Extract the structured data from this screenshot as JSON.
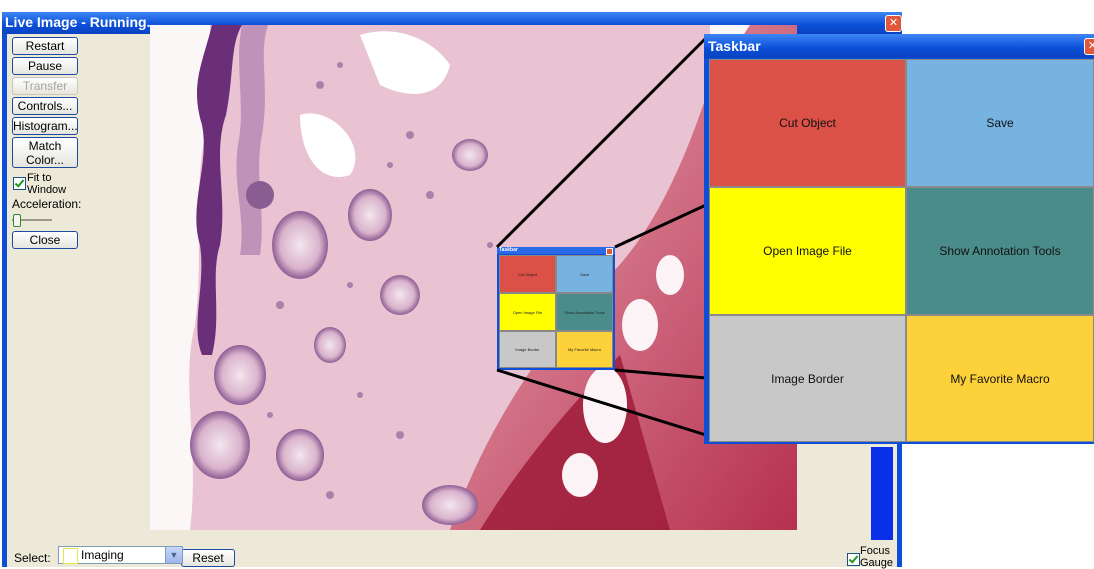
{
  "window": {
    "title": "Live Image - Running...",
    "close_icon": "close-icon"
  },
  "left_panel": {
    "restart": "Restart",
    "pause": "Pause",
    "transfer": "Transfer",
    "controls": "Controls...",
    "histogram": "Histogram...",
    "match_color_line1": "Match",
    "match_color_line2": "Color...",
    "fit_to_window_line1": "Fit to",
    "fit_to_window_line2": "Window",
    "fit_to_window_checked": true,
    "acceleration_label": "Acceleration:",
    "acceleration_level": 0,
    "close": "Close"
  },
  "bottom_bar": {
    "select_label": "Select:",
    "select_value": "Imaging",
    "reset": "Reset",
    "focus_gauge_line1": "Focus",
    "focus_gauge_line2": "Gauge",
    "focus_gauge_checked": true
  },
  "taskbar": {
    "title": "Taskbar",
    "tiles": [
      {
        "label": "Cut Object",
        "color": "#db5047"
      },
      {
        "label": "Save",
        "color": "#76b3e1"
      },
      {
        "label": "Open Image File",
        "color": "#ffff00"
      },
      {
        "label": "Show Annotation Tools",
        "color": "#4a8c8a"
      },
      {
        "label": "Image Border",
        "color": "#c8c8c8"
      },
      {
        "label": "My Favorite Macro",
        "color": "#fdd13a"
      }
    ]
  },
  "colors": {
    "titlebar": "#0a4ed8",
    "window_bg": "#ece9d8",
    "focus_gauge_fill": "#0a2fe8"
  }
}
